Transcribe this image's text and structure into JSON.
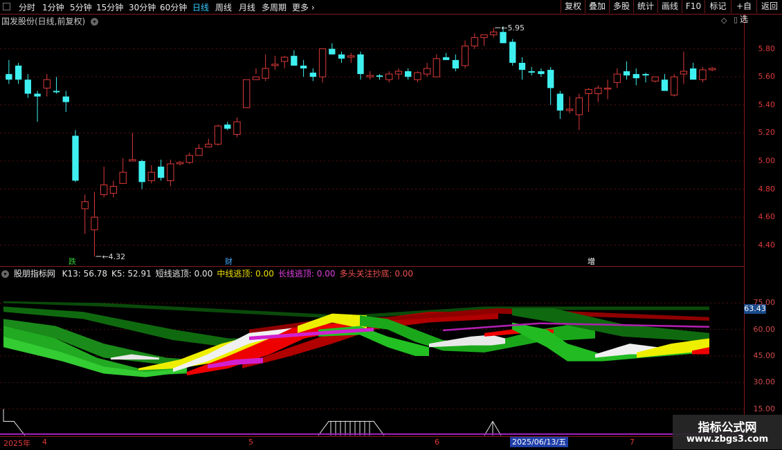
{
  "toolbar": {
    "timeframes": [
      "分时",
      "1分钟",
      "5分钟",
      "15分钟",
      "30分钟",
      "60分钟",
      "日线",
      "周线",
      "月线",
      "多周期",
      "更多"
    ],
    "active_timeframe": "日线",
    "more_arrow": "›",
    "right_buttons": [
      "复权",
      "叠加",
      "多股",
      "统计",
      "画线",
      "F10",
      "标记",
      "+自选",
      "返回"
    ]
  },
  "main_chart": {
    "title": "国发股份(日线,前复权)",
    "menu_icon": "chevron-down-icon",
    "y_ticks": [
      "5.80",
      "5.60",
      "5.40",
      "5.20",
      "5.00",
      "4.80",
      "4.60",
      "4.40"
    ],
    "high_label": "5.95",
    "low_label": "4.32",
    "tags": [
      {
        "text": "跌",
        "color": "#3c3"
      },
      {
        "text": "财",
        "color": "#4af"
      },
      {
        "text": "增",
        "color": "#fff"
      }
    ],
    "up_color": "#e03a3a",
    "down_color": "#3ff0f0"
  },
  "indicator": {
    "name": "股朋指标网",
    "items": [
      {
        "label": "K13: 56.78",
        "color": "#e8e8e8"
      },
      {
        "label": "K5: 52.91",
        "color": "#e8e8e8"
      },
      {
        "label": "短线逃顶: 0.00",
        "color": "#e8e8e8"
      },
      {
        "label": "中线逃顶: 0.00",
        "color": "#f0e000"
      },
      {
        "label": "长线逃顶: 0.00",
        "color": "#e040e0"
      },
      {
        "label": "多头关注抄底: 0.00",
        "color": "#f05050"
      }
    ],
    "y_ticks": [
      "75.00",
      "60.00",
      "45.00",
      "30.00",
      "15.00"
    ],
    "current_value": "63.43"
  },
  "x_axis": {
    "labels": [
      "2025年",
      "4",
      "5",
      "6",
      "7"
    ],
    "crosshair_date": "2025/06/13/五"
  },
  "watermark": {
    "title": "指标公式网",
    "url": "www.zbgs3.com"
  },
  "chart_data": {
    "type": "candlestick",
    "title": "国发股份(日线,前复权)",
    "ylim": [
      4.3,
      6.0
    ],
    "candles": [
      [
        5.62,
        5.72,
        5.55,
        5.58
      ],
      [
        5.68,
        5.7,
        5.55,
        5.58
      ],
      [
        5.58,
        5.62,
        5.45,
        5.48
      ],
      [
        5.48,
        5.5,
        5.28,
        5.46
      ],
      [
        5.52,
        5.62,
        5.46,
        5.58
      ],
      [
        5.5,
        5.6,
        5.48,
        5.49
      ],
      [
        5.46,
        5.5,
        5.35,
        5.42
      ],
      [
        5.18,
        5.22,
        4.85,
        4.86
      ],
      [
        4.66,
        4.76,
        4.48,
        4.71
      ],
      [
        4.51,
        4.78,
        4.32,
        4.6
      ],
      [
        4.76,
        4.96,
        4.74,
        4.83
      ],
      [
        4.77,
        4.86,
        4.74,
        4.82
      ],
      [
        4.84,
        5.02,
        4.84,
        4.92
      ],
      [
        5.0,
        5.2,
        5.0,
        5.01
      ],
      [
        5.0,
        5.01,
        4.8,
        4.85
      ],
      [
        4.86,
        4.97,
        4.84,
        4.92
      ],
      [
        4.96,
        5.01,
        4.86,
        4.88
      ],
      [
        4.86,
        5.01,
        4.82,
        4.98
      ],
      [
        4.98,
        5.0,
        4.97,
        4.99
      ],
      [
        4.99,
        5.06,
        4.98,
        5.04
      ],
      [
        5.04,
        5.12,
        5.04,
        5.09
      ],
      [
        5.1,
        5.16,
        5.1,
        5.12
      ],
      [
        5.12,
        5.26,
        5.11,
        5.25
      ],
      [
        5.26,
        5.28,
        5.22,
        5.23
      ],
      [
        5.19,
        5.31,
        5.17,
        5.28
      ],
      [
        5.38,
        5.58,
        5.38,
        5.58
      ],
      [
        5.58,
        5.66,
        5.62,
        5.6
      ],
      [
        5.59,
        5.76,
        5.57,
        5.66
      ],
      [
        5.68,
        5.75,
        5.65,
        5.69
      ],
      [
        5.71,
        5.75,
        5.66,
        5.74
      ],
      [
        5.75,
        5.79,
        5.7,
        5.68
      ],
      [
        5.68,
        5.72,
        5.6,
        5.66
      ],
      [
        5.63,
        5.66,
        5.57,
        5.6
      ],
      [
        5.6,
        5.78,
        5.56,
        5.8
      ],
      [
        5.8,
        5.84,
        5.76,
        5.76
      ],
      [
        5.76,
        5.78,
        5.7,
        5.73
      ],
      [
        5.74,
        5.77,
        5.7,
        5.75
      ],
      [
        5.76,
        5.78,
        5.58,
        5.62
      ],
      [
        5.6,
        5.64,
        5.58,
        5.61
      ],
      [
        5.61,
        5.62,
        5.58,
        5.6
      ],
      [
        5.58,
        5.64,
        5.56,
        5.62
      ],
      [
        5.62,
        5.66,
        5.58,
        5.64
      ],
      [
        5.64,
        5.66,
        5.58,
        5.6
      ],
      [
        5.58,
        5.64,
        5.56,
        5.63
      ],
      [
        5.62,
        5.7,
        5.6,
        5.66
      ],
      [
        5.6,
        5.76,
        5.6,
        5.73
      ],
      [
        5.74,
        5.77,
        5.72,
        5.72
      ],
      [
        5.72,
        5.76,
        5.64,
        5.66
      ],
      [
        5.68,
        5.86,
        5.66,
        5.82
      ],
      [
        5.82,
        5.91,
        5.8,
        5.88
      ],
      [
        5.88,
        5.9,
        5.82,
        5.9
      ],
      [
        5.9,
        5.95,
        5.88,
        5.92
      ],
      [
        5.92,
        5.96,
        5.84,
        5.84
      ],
      [
        5.85,
        5.87,
        5.68,
        5.7
      ],
      [
        5.7,
        5.74,
        5.58,
        5.65
      ],
      [
        5.64,
        5.67,
        5.61,
        5.63
      ],
      [
        5.64,
        5.66,
        5.6,
        5.62
      ],
      [
        5.65,
        5.67,
        5.4,
        5.52
      ],
      [
        5.48,
        5.5,
        5.3,
        5.36
      ],
      [
        5.36,
        5.46,
        5.34,
        5.37
      ],
      [
        5.33,
        5.48,
        5.22,
        5.45
      ],
      [
        5.48,
        5.52,
        5.35,
        5.51
      ],
      [
        5.48,
        5.54,
        5.42,
        5.52
      ],
      [
        5.52,
        5.58,
        5.44,
        5.52
      ],
      [
        5.56,
        5.66,
        5.52,
        5.62
      ],
      [
        5.64,
        5.71,
        5.58,
        5.61
      ],
      [
        5.62,
        5.66,
        5.54,
        5.59
      ],
      [
        5.62,
        5.63,
        5.56,
        5.61
      ],
      [
        5.57,
        5.6,
        5.56,
        5.6
      ],
      [
        5.58,
        5.62,
        5.5,
        5.5
      ],
      [
        5.47,
        5.62,
        5.46,
        5.6
      ],
      [
        5.62,
        5.78,
        5.55,
        5.64
      ],
      [
        5.66,
        5.7,
        5.58,
        5.58
      ],
      [
        5.58,
        5.67,
        5.56,
        5.65
      ],
      [
        5.65,
        5.67,
        5.64,
        5.66
      ]
    ],
    "indicator_series": [
      {
        "name": "K13",
        "value": 56.78
      },
      {
        "name": "K5",
        "value": 52.91
      }
    ],
    "indicator_ylim": [
      0,
      90
    ]
  }
}
